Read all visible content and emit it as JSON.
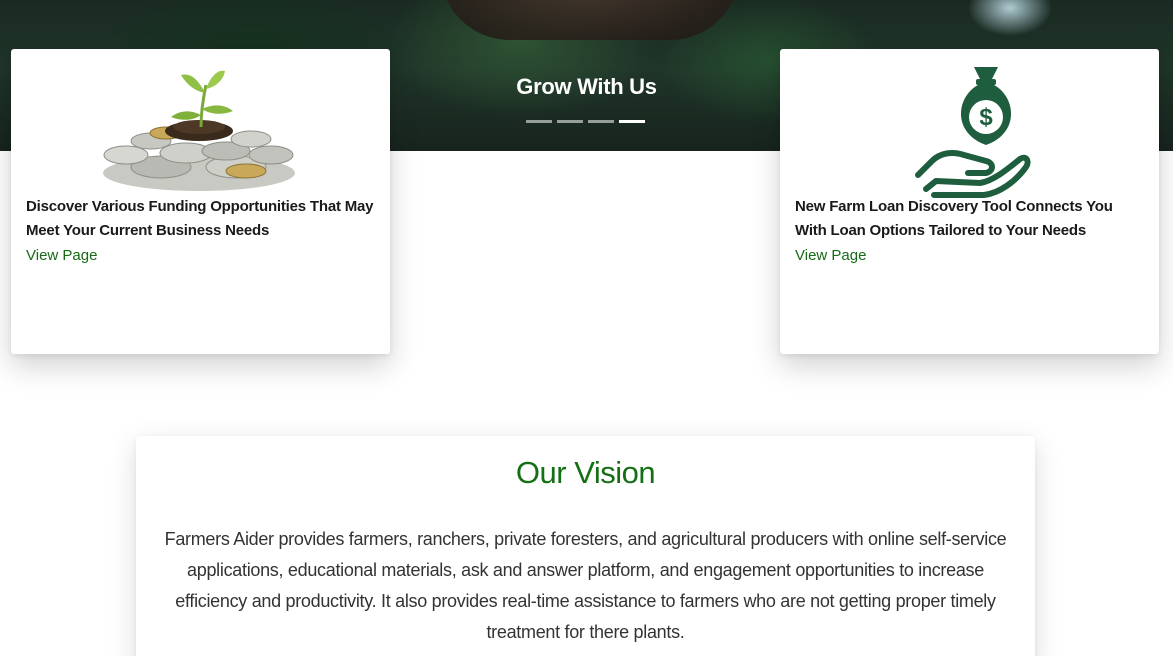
{
  "hero": {
    "title": "Grow With Us",
    "slide_count": 4,
    "active_slide": 4
  },
  "cards": [
    {
      "image": "coins-with-seedling-image",
      "title": "Discover Various Funding Opportunities That May Meet Your Current Business Needs",
      "link_label": "View Page"
    },
    {
      "image": "money-bag-hand-icon",
      "title": "New Farm Loan Discovery Tool Connects You With Loan Options Tailored to Your Needs",
      "link_label": "View Page"
    }
  ],
  "vision": {
    "title": "Our Vision",
    "text": "Farmers Aider provides farmers, ranchers, private foresters, and agricultural producers with online self-service applications, educational materials, ask and answer platform, and engagement opportunities to increase efficiency and productivity. It also provides real-time assistance to farmers who are not getting proper timely treatment for there plants."
  },
  "colors": {
    "accent_green": "#157015",
    "link_green": "#166a16",
    "icon_green": "#1e5e3e"
  }
}
